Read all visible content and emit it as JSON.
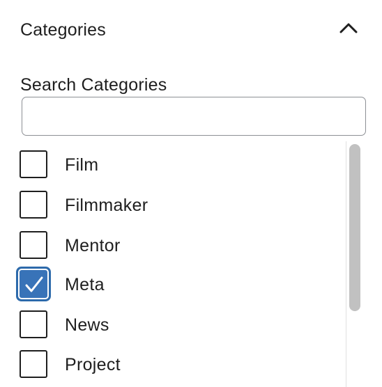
{
  "panel": {
    "title": "Categories",
    "toggle_icon": "chevron-up-icon",
    "expanded": true
  },
  "search": {
    "label": "Search Categories",
    "value": "",
    "placeholder": ""
  },
  "categories": [
    {
      "label": "Film",
      "checked": false
    },
    {
      "label": "Filmmaker",
      "checked": false
    },
    {
      "label": "Mentor",
      "checked": false
    },
    {
      "label": "Meta",
      "checked": true
    },
    {
      "label": "News",
      "checked": false
    },
    {
      "label": "Project",
      "checked": false
    }
  ],
  "colors": {
    "checked_fill": "#3873b8",
    "text": "#1e1e1e",
    "input_border": "#8c8f94",
    "scrollbar_thumb": "#c1c1c1"
  }
}
